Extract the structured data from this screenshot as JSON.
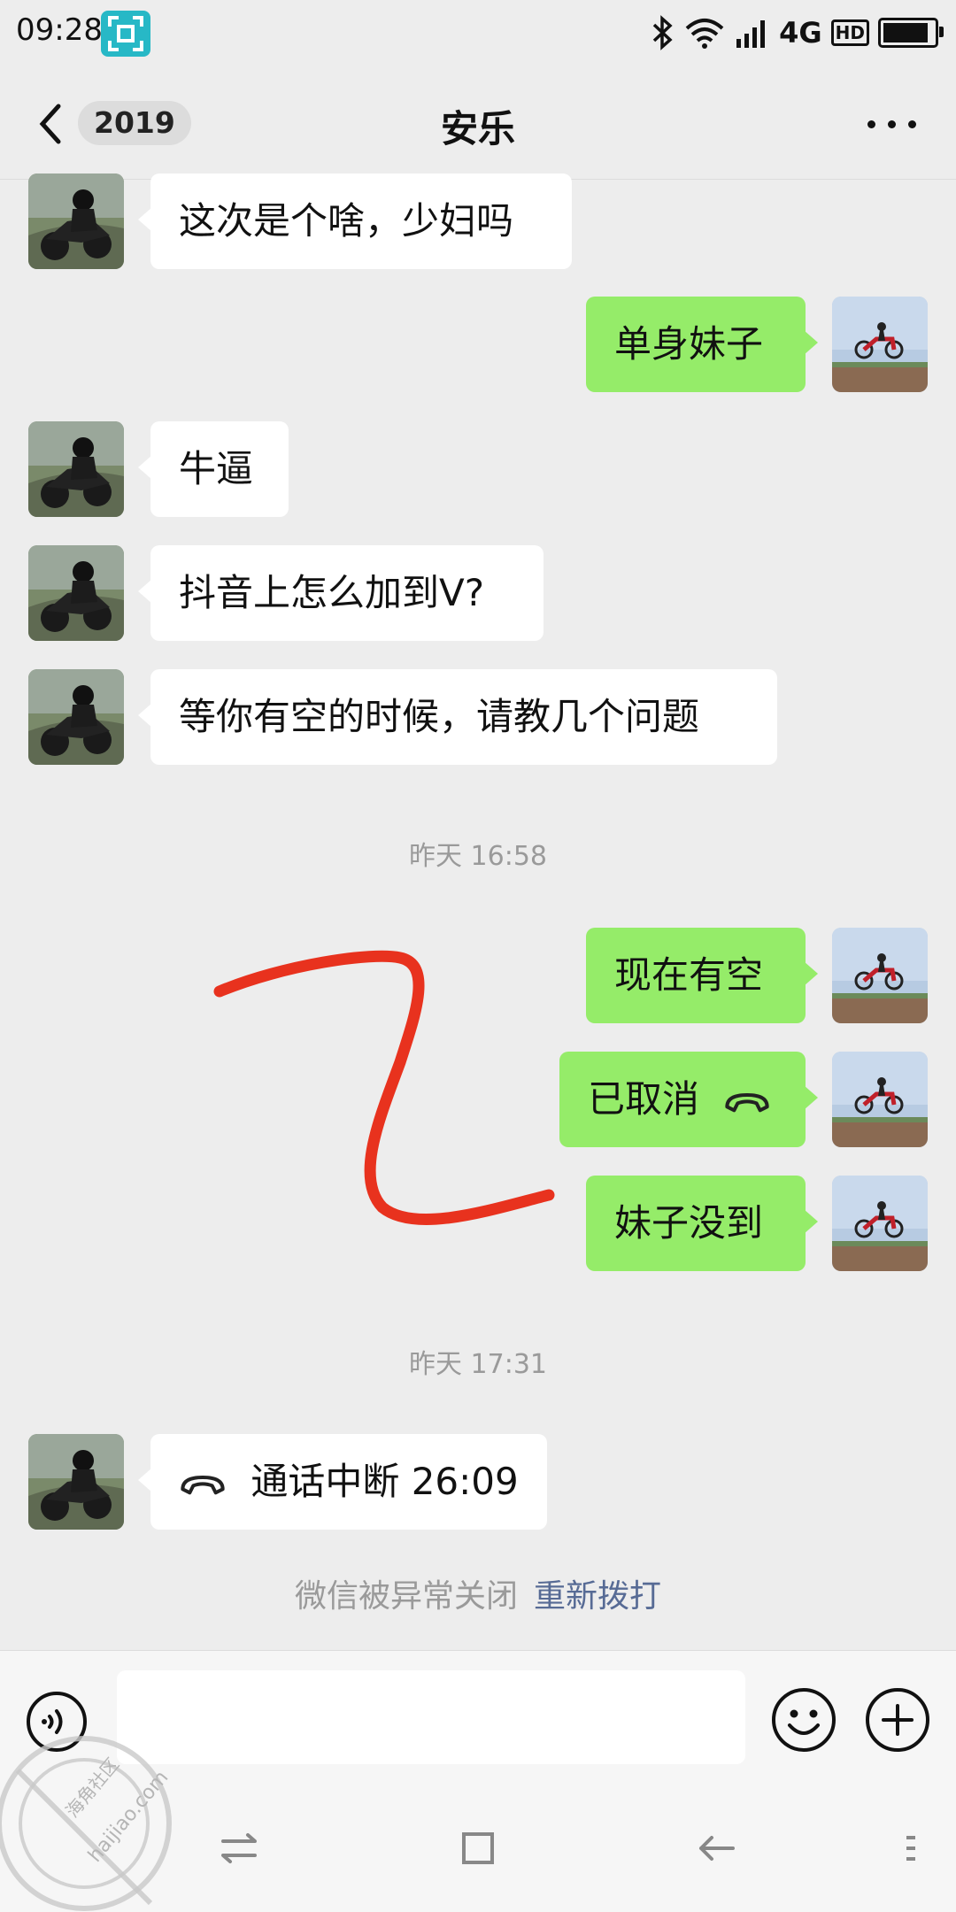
{
  "status_bar": {
    "time": "09:28",
    "network": "4G",
    "hd": "HD",
    "battery_level": 0.9
  },
  "nav": {
    "unread_badge": "2019",
    "title": "安乐"
  },
  "messages": [
    {
      "side": "in",
      "text": "这次是个啥，少妇吗"
    },
    {
      "side": "out",
      "text": "单身妹子"
    },
    {
      "side": "in",
      "text": "牛逼"
    },
    {
      "side": "in",
      "text": "抖音上怎么加到V?"
    },
    {
      "side": "in",
      "text": "等你有空的时候，请教几个问题"
    },
    {
      "type": "timestamp",
      "text": "昨天 16:58"
    },
    {
      "side": "out",
      "text": "现在有空"
    },
    {
      "side": "out",
      "text": "已取消",
      "icon": "phone-hangup-icon"
    },
    {
      "side": "out",
      "text": "妹子没到"
    },
    {
      "type": "timestamp",
      "text": "昨天 17:31"
    },
    {
      "side": "in",
      "text": "通话中断 26:09",
      "icon": "phone-hangup-icon"
    }
  ],
  "notice": {
    "text": "微信被异常关闭",
    "link": "重新拨打"
  },
  "input": {
    "value": "",
    "placeholder": ""
  },
  "icons": {
    "voice": "voice-icon",
    "emoji": "emoji-icon",
    "plus": "plus-icon",
    "back": "back-chevron-icon",
    "more": "more-dots-icon"
  },
  "watermark": {
    "text_cn": "海角社区",
    "text_en": "haijiao.com"
  },
  "colors": {
    "background": "#ededed",
    "outgoing_bubble": "#95ec69",
    "incoming_bubble": "#ffffff",
    "link": "#576b95",
    "annotation": "#e8321e"
  }
}
